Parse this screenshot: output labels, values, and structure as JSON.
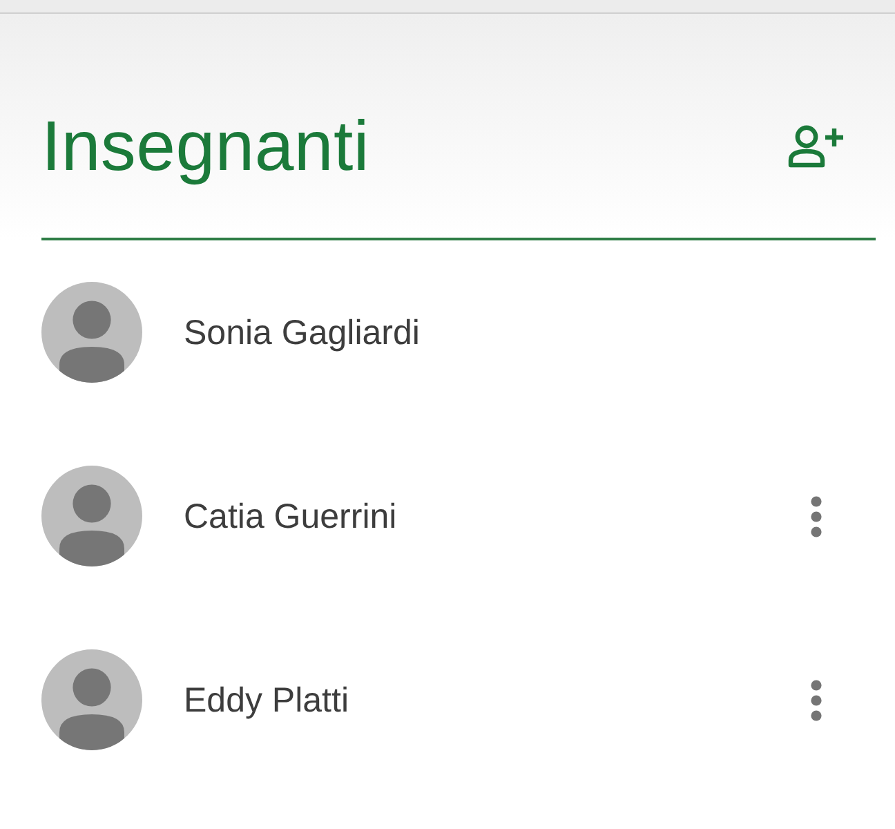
{
  "header": {
    "title": "Insegnanti"
  },
  "teachers": [
    {
      "name": "Sonia Gagliardi",
      "has_menu": false
    },
    {
      "name": "Catia Guerrini",
      "has_menu": true
    },
    {
      "name": "Eddy Platti",
      "has_menu": true
    }
  ]
}
